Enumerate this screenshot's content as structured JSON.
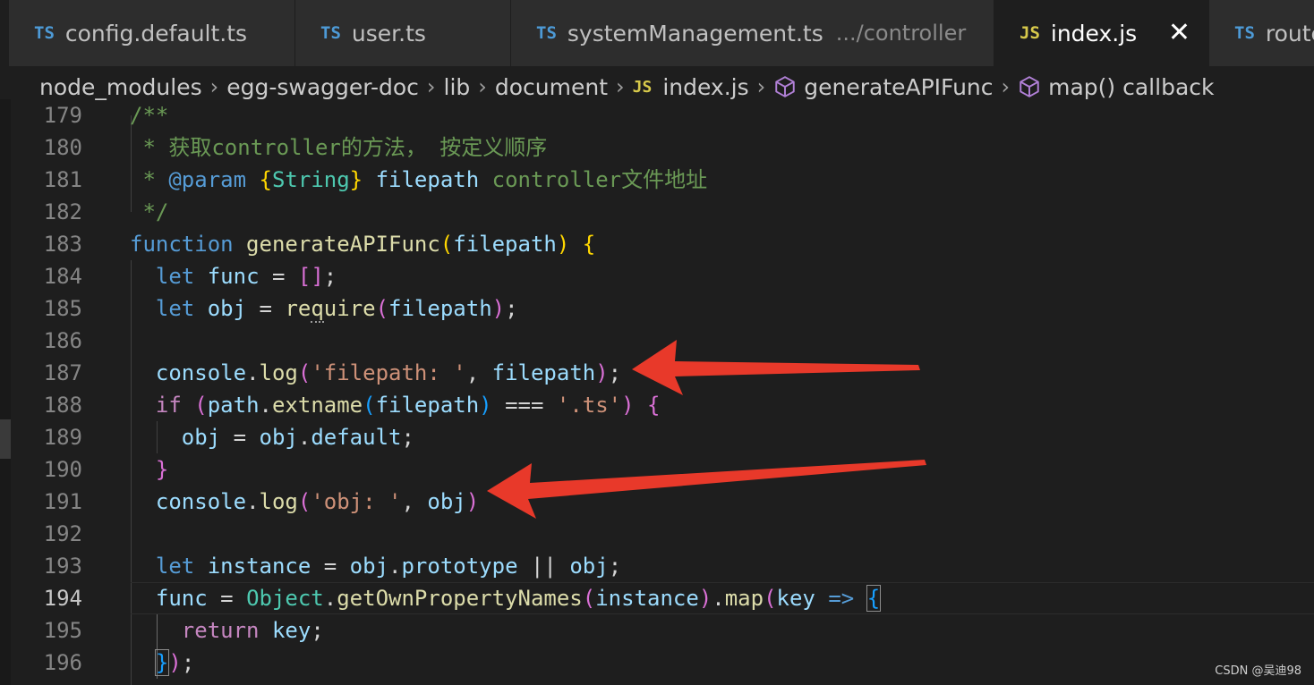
{
  "tabs": [
    {
      "lang": "TS",
      "title": "config.default.ts",
      "desc": ""
    },
    {
      "lang": "TS",
      "title": "user.ts",
      "desc": ""
    },
    {
      "lang": "TS",
      "title": "systemManagement.ts",
      "desc": ".../controller"
    },
    {
      "lang": "JS",
      "title": "index.js",
      "desc": "",
      "close": "✕"
    },
    {
      "lang": "TS",
      "title": "route",
      "desc": ""
    }
  ],
  "breadcrumb": {
    "items": [
      "node_modules",
      "egg-swagger-doc",
      "lib",
      "document"
    ],
    "file_lang": "JS",
    "file": "index.js",
    "symbol1": "generateAPIFunc",
    "symbol2": "map() callback"
  },
  "editor": {
    "current_line": 194,
    "lines": [
      {
        "n": "179",
        "t": [
          [
            "/**",
            "cm"
          ]
        ]
      },
      {
        "n": "180",
        "t": [
          [
            " * 获取controller的方法， 按定义顺序",
            "cm"
          ]
        ]
      },
      {
        "n": "181",
        "t": [
          [
            " * ",
            "cm"
          ],
          [
            "@param",
            "kw"
          ],
          [
            " ",
            "cm"
          ],
          [
            "{",
            "p1"
          ],
          [
            "String",
            "cls"
          ],
          [
            "}",
            "p1"
          ],
          [
            " ",
            "cm"
          ],
          [
            "filepath",
            "var"
          ],
          [
            " controller文件地址",
            "cm"
          ]
        ]
      },
      {
        "n": "182",
        "t": [
          [
            " */",
            "cm"
          ]
        ]
      },
      {
        "n": "183",
        "t": [
          [
            "function",
            "kw"
          ],
          [
            " ",
            "op"
          ],
          [
            "generateAPIFunc",
            "fn"
          ],
          [
            "(",
            "p1"
          ],
          [
            "filepath",
            "var"
          ],
          [
            ")",
            "p1"
          ],
          [
            " ",
            "op"
          ],
          [
            "{",
            "p1"
          ]
        ]
      },
      {
        "n": "184",
        "t": [
          [
            "  ",
            "op"
          ],
          [
            "let",
            "kw"
          ],
          [
            " ",
            "op"
          ],
          [
            "func",
            "var"
          ],
          [
            " = ",
            "op"
          ],
          [
            "[]",
            "p2"
          ],
          [
            ";",
            "op"
          ]
        ]
      },
      {
        "n": "185",
        "t": [
          [
            "  ",
            "op"
          ],
          [
            "let",
            "kw"
          ],
          [
            " ",
            "op"
          ],
          [
            "obj",
            "var"
          ],
          [
            " = ",
            "op"
          ],
          [
            "re",
            "fn"
          ],
          [
            "q",
            "fn dotted"
          ],
          [
            "uire",
            "fn"
          ],
          [
            "(",
            "p2"
          ],
          [
            "filepath",
            "var"
          ],
          [
            ")",
            "p2"
          ],
          [
            ";",
            "op"
          ]
        ]
      },
      {
        "n": "186",
        "t": []
      },
      {
        "n": "187",
        "t": [
          [
            "  ",
            "op"
          ],
          [
            "console",
            "var"
          ],
          [
            ".",
            "op"
          ],
          [
            "log",
            "fn"
          ],
          [
            "(",
            "p2"
          ],
          [
            "'filepath: '",
            "str"
          ],
          [
            ", ",
            "op"
          ],
          [
            "filepath",
            "var"
          ],
          [
            ")",
            "p2"
          ],
          [
            ";",
            "op"
          ]
        ]
      },
      {
        "n": "188",
        "t": [
          [
            "  ",
            "op"
          ],
          [
            "if",
            "ctl"
          ],
          [
            " ",
            "op"
          ],
          [
            "(",
            "p2"
          ],
          [
            "path",
            "var"
          ],
          [
            ".",
            "op"
          ],
          [
            "extname",
            "fn"
          ],
          [
            "(",
            "p3"
          ],
          [
            "filepath",
            "var"
          ],
          [
            ")",
            "p3"
          ],
          [
            " === ",
            "op"
          ],
          [
            "'.ts'",
            "str"
          ],
          [
            ")",
            "p2"
          ],
          [
            " ",
            "op"
          ],
          [
            "{",
            "p2"
          ]
        ]
      },
      {
        "n": "189",
        "t": [
          [
            "    ",
            "op"
          ],
          [
            "obj",
            "var"
          ],
          [
            " = ",
            "op"
          ],
          [
            "obj",
            "var"
          ],
          [
            ".",
            "op"
          ],
          [
            "default",
            "var"
          ],
          [
            ";",
            "op"
          ]
        ]
      },
      {
        "n": "190",
        "t": [
          [
            "  ",
            "op"
          ],
          [
            "}",
            "p2"
          ]
        ]
      },
      {
        "n": "191",
        "t": [
          [
            "  ",
            "op"
          ],
          [
            "console",
            "var"
          ],
          [
            ".",
            "op"
          ],
          [
            "log",
            "fn"
          ],
          [
            "(",
            "p2"
          ],
          [
            "'obj: '",
            "str"
          ],
          [
            ", ",
            "op"
          ],
          [
            "obj",
            "var"
          ],
          [
            ")",
            "p2"
          ]
        ]
      },
      {
        "n": "192",
        "t": []
      },
      {
        "n": "193",
        "t": [
          [
            "  ",
            "op"
          ],
          [
            "let",
            "kw"
          ],
          [
            " ",
            "op"
          ],
          [
            "instance",
            "var"
          ],
          [
            " = ",
            "op"
          ],
          [
            "obj",
            "var"
          ],
          [
            ".",
            "op"
          ],
          [
            "prototype",
            "var"
          ],
          [
            " || ",
            "op"
          ],
          [
            "obj",
            "var"
          ],
          [
            ";",
            "op"
          ]
        ]
      },
      {
        "n": "194",
        "t": [
          [
            "  ",
            "op"
          ],
          [
            "func",
            "var"
          ],
          [
            " = ",
            "op"
          ],
          [
            "Object",
            "cls"
          ],
          [
            ".",
            "op"
          ],
          [
            "getOwnPropertyNames",
            "fn"
          ],
          [
            "(",
            "p2"
          ],
          [
            "instance",
            "var"
          ],
          [
            ")",
            "p2"
          ],
          [
            ".",
            "op"
          ],
          [
            "map",
            "fn"
          ],
          [
            "(",
            "p2"
          ],
          [
            "key",
            "var"
          ],
          [
            " ",
            "op"
          ],
          [
            "=>",
            "kw"
          ],
          [
            " ",
            "op"
          ],
          [
            "{",
            "p3 bracket-box"
          ]
        ]
      },
      {
        "n": "195",
        "t": [
          [
            "    ",
            "op"
          ],
          [
            "return",
            "ctl"
          ],
          [
            " ",
            "op"
          ],
          [
            "key",
            "var"
          ],
          [
            ";",
            "op"
          ]
        ]
      },
      {
        "n": "196",
        "t": [
          [
            "  ",
            "op"
          ],
          [
            "}",
            "p3 bracket-box"
          ],
          [
            ")",
            "p2"
          ],
          [
            ";",
            "op"
          ]
        ]
      }
    ]
  },
  "annotation_color": "#e8392a",
  "watermark": "CSDN @吴迪98"
}
